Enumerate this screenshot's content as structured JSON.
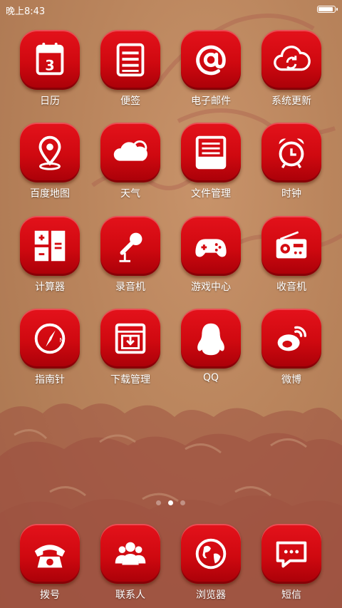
{
  "statusbar": {
    "time": "晚上8:43",
    "battery_level": 0.95
  },
  "pager": {
    "page_count": 3,
    "active_index": 1
  },
  "apps": [
    {
      "label": "日历",
      "icon": "calendar-icon",
      "day": "3"
    },
    {
      "label": "便签",
      "icon": "notes-icon"
    },
    {
      "label": "电子邮件",
      "icon": "email-at-icon"
    },
    {
      "label": "系统更新",
      "icon": "cloud-update-icon"
    },
    {
      "label": "百度地图",
      "icon": "map-pin-icon"
    },
    {
      "label": "天气",
      "icon": "weather-cloud-icon"
    },
    {
      "label": "文件管理",
      "icon": "file-drawer-icon"
    },
    {
      "label": "时钟",
      "icon": "alarm-clock-icon"
    },
    {
      "label": "计算器",
      "icon": "calculator-icon"
    },
    {
      "label": "录音机",
      "icon": "microphone-icon"
    },
    {
      "label": "游戏中心",
      "icon": "gamepad-icon"
    },
    {
      "label": "收音机",
      "icon": "radio-icon"
    },
    {
      "label": "指南针",
      "icon": "compass-icon",
      "compass_letter": "N"
    },
    {
      "label": "下载管理",
      "icon": "download-icon"
    },
    {
      "label": "QQ",
      "icon": "qq-penguin-icon"
    },
    {
      "label": "微博",
      "icon": "weibo-icon"
    }
  ],
  "dock": [
    {
      "label": "拨号",
      "icon": "phone-icon"
    },
    {
      "label": "联系人",
      "icon": "contacts-icon"
    },
    {
      "label": "浏览器",
      "icon": "globe-icon"
    },
    {
      "label": "短信",
      "icon": "sms-icon"
    }
  ],
  "colors": {
    "tile_red": "#d40c12",
    "wallpaper": "#b9845c",
    "cloud_pattern": "#9a4a3e"
  }
}
